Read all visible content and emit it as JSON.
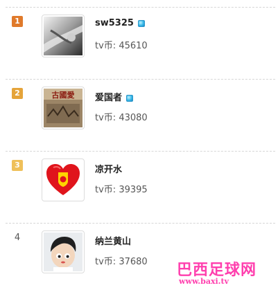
{
  "leaderboard": [
    {
      "rank": "1",
      "name": "sw5325",
      "coins_label": "tv币:",
      "coins": "45610",
      "verified": true,
      "rank_style": "r1"
    },
    {
      "rank": "2",
      "name": "爱国者",
      "coins_label": "tv币:",
      "coins": "43080",
      "verified": true,
      "rank_style": "r2"
    },
    {
      "rank": "3",
      "name": "凉开水",
      "coins_label": "tv币:",
      "coins": "39395",
      "verified": false,
      "rank_style": "r3"
    },
    {
      "rank": "4",
      "name": "纳兰黄山",
      "coins_label": "tv币:",
      "coins": "37680",
      "verified": false,
      "rank_style": "plain"
    }
  ],
  "watermark": {
    "brand": "巴西足球网",
    "url": "www.baxi.tv"
  },
  "avatar_content": {
    "row2_text": "古國愛"
  },
  "colors": {
    "rank1": "#e07a2b",
    "rank2": "#e5a43a",
    "rank3": "#efc05a",
    "watermark": "#ff3fae"
  }
}
